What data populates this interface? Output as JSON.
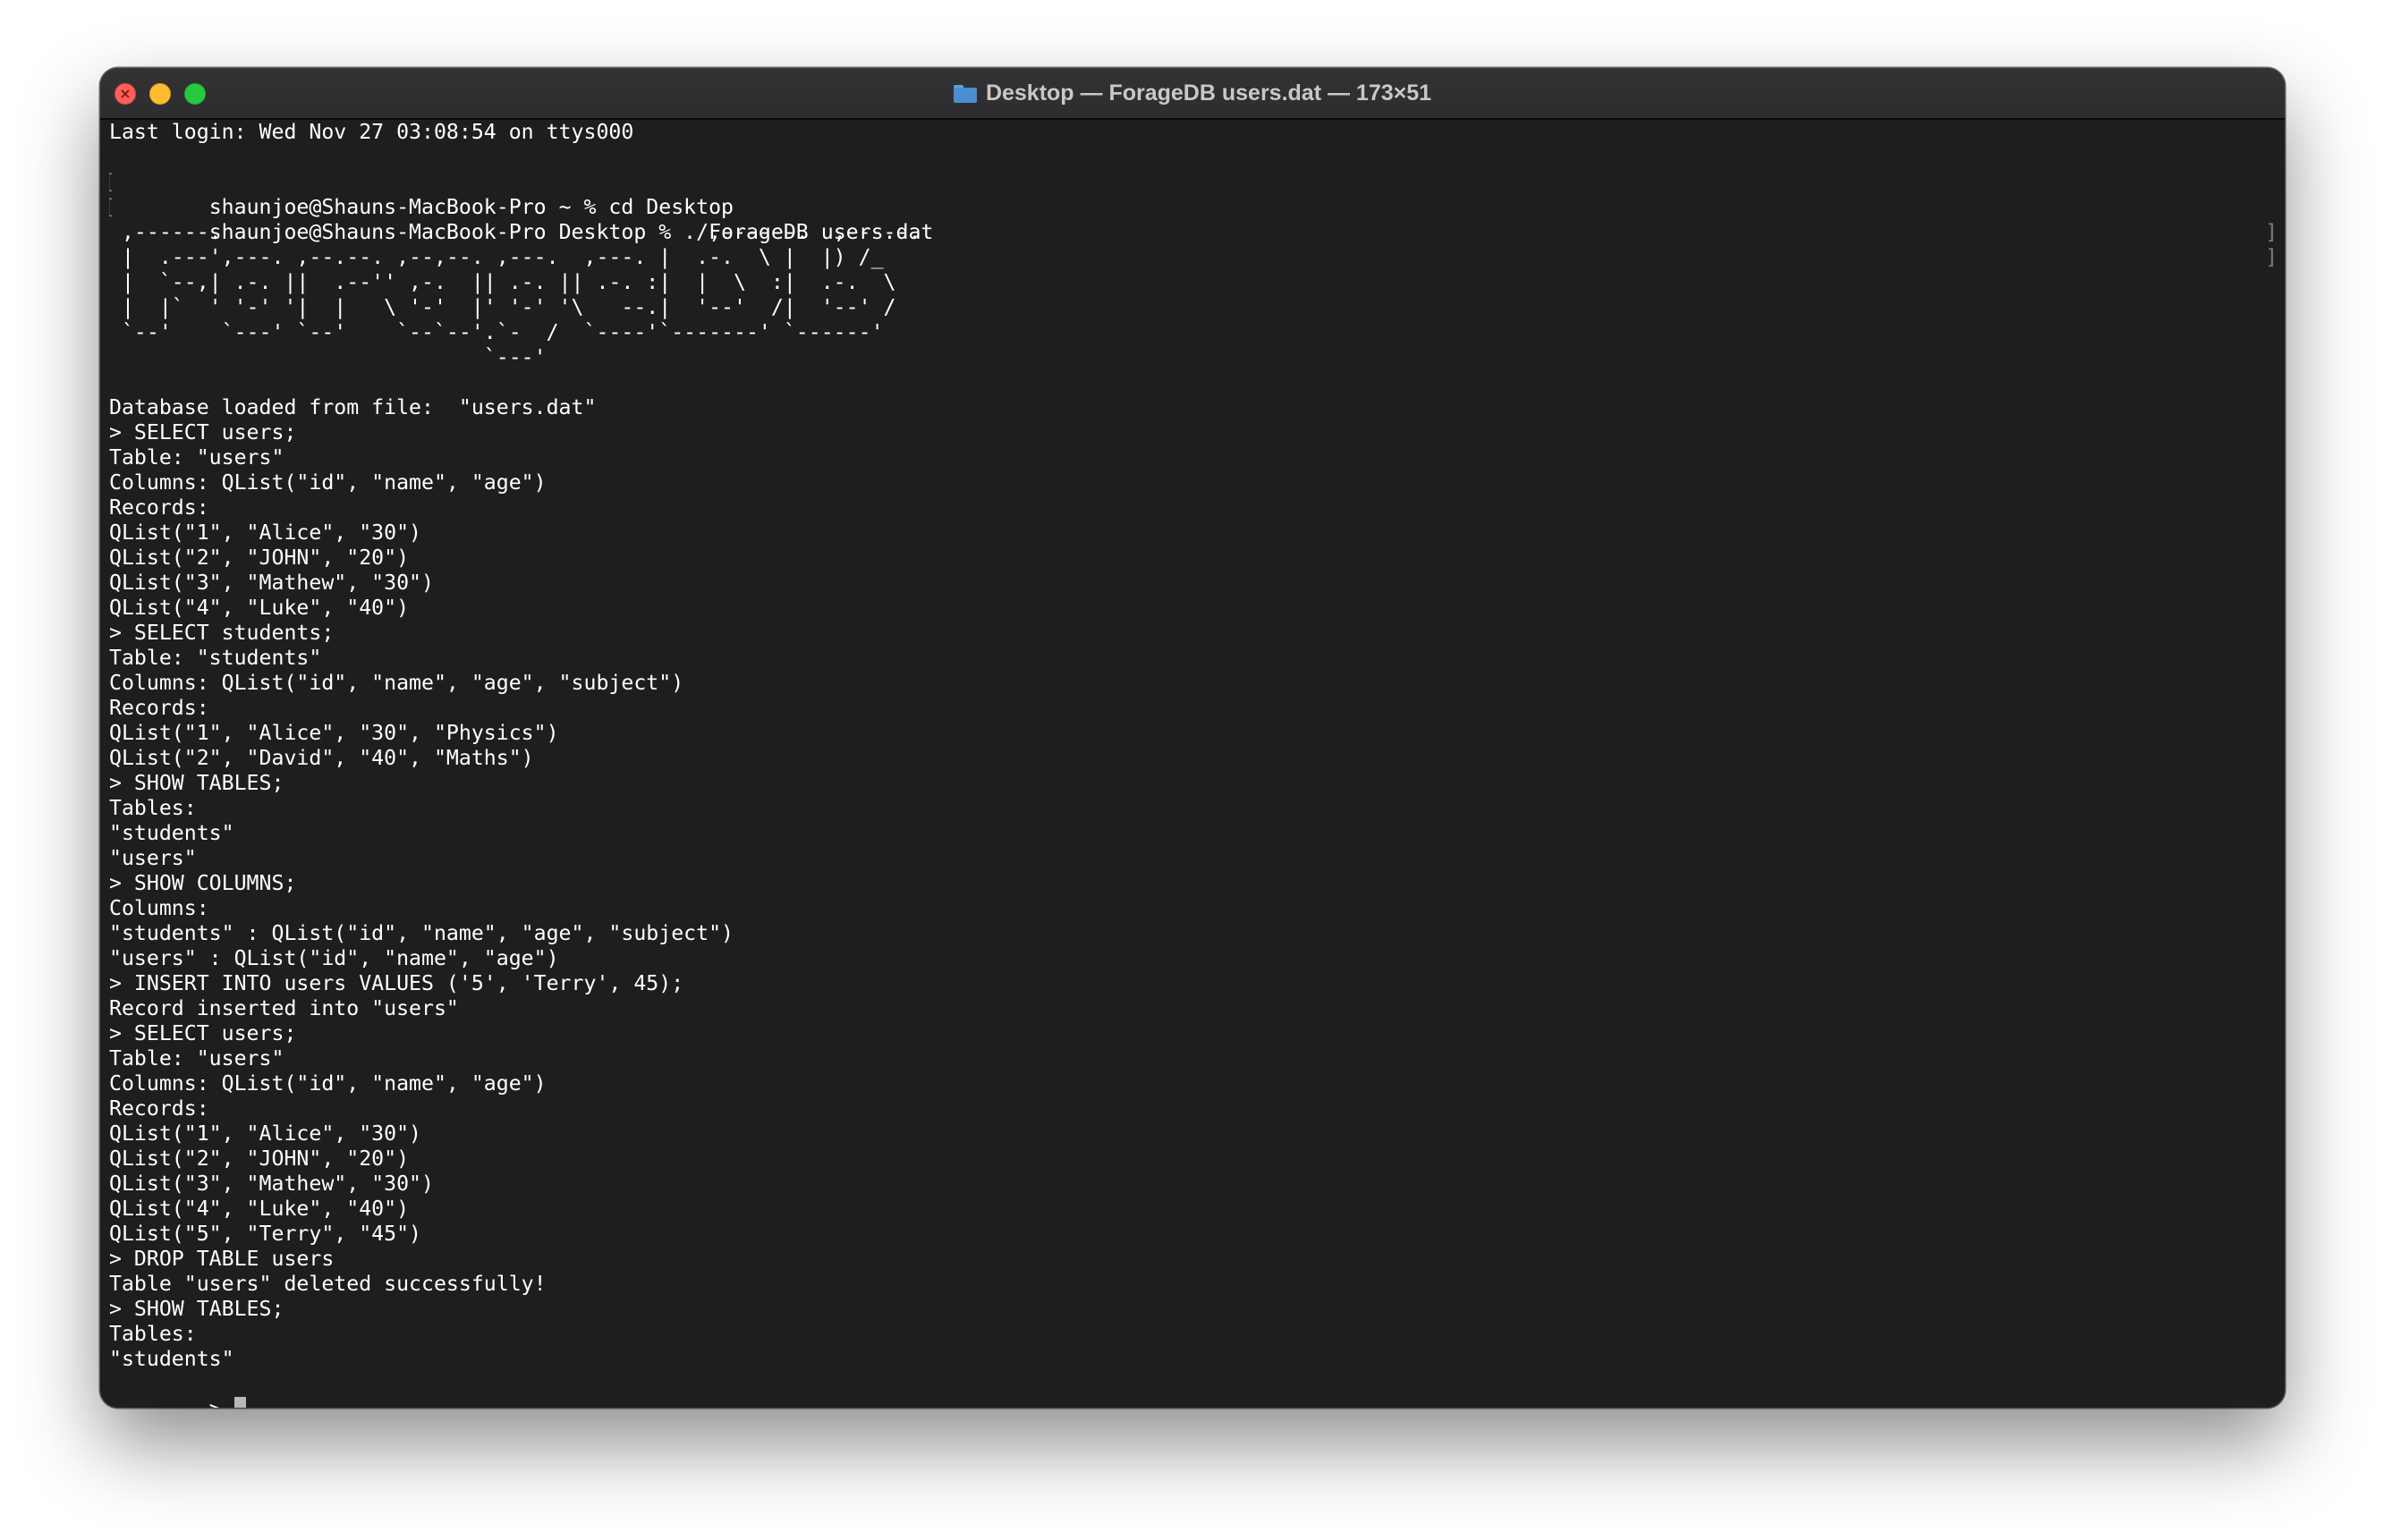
{
  "window": {
    "title": "Desktop — ForageDB users.dat — 173×51",
    "folder_icon": "folder-icon",
    "close_icon": "close-icon",
    "minimize_icon": "minimize-icon",
    "zoom_icon": "zoom-icon",
    "close_glyph": "×"
  },
  "session": {
    "last_login": "Last login: Wed Nov 27 03:08:54 on ttys000",
    "cmd_cd": "shaunjoe@Shauns-MacBook-Pro ~ % cd Desktop",
    "cmd_run": "shaunjoe@Shauns-MacBook-Pro Desktop % ./ForageDB users.dat",
    "bracket_open": "[",
    "bracket_close": "]"
  },
  "banner": " ,------.                                       ,------.  ,-----.\n |  .---',---. ,--.--. ,--,--. ,---.  ,---. |  .-.  \\ |  |) /_\n |  `--,| .-. ||  .--'' ,-.  || .-. || .-. :|  |  \\  :|  .-.  \\\n |  |`  ' '-' '|  |   \\ '-'  |' '-' '\\   --.|  '--'  /|  '--' /\n `--'    `---' `--'    `--`--'.`-  /  `----'`-------' `------'\n                              `---'",
  "output": [
    "",
    "Database loaded from file:  \"users.dat\"",
    "> SELECT users;",
    "Table: \"users\"",
    "Columns: QList(\"id\", \"name\", \"age\")",
    "Records:",
    "QList(\"1\", \"Alice\", \"30\")",
    "QList(\"2\", \"JOHN\", \"20\")",
    "QList(\"3\", \"Mathew\", \"30\")",
    "QList(\"4\", \"Luke\", \"40\")",
    "> SELECT students;",
    "Table: \"students\"",
    "Columns: QList(\"id\", \"name\", \"age\", \"subject\")",
    "Records:",
    "QList(\"1\", \"Alice\", \"30\", \"Physics\")",
    "QList(\"2\", \"David\", \"40\", \"Maths\")",
    "> SHOW TABLES;",
    "Tables:",
    "\"students\"",
    "\"users\"",
    "> SHOW COLUMNS;",
    "Columns:",
    "\"students\" : QList(\"id\", \"name\", \"age\", \"subject\")",
    "\"users\" : QList(\"id\", \"name\", \"age\")",
    "> INSERT INTO users VALUES ('5', 'Terry', 45);",
    "Record inserted into \"users\"",
    "> SELECT users;",
    "Table: \"users\"",
    "Columns: QList(\"id\", \"name\", \"age\")",
    "Records:",
    "QList(\"1\", \"Alice\", \"30\")",
    "QList(\"2\", \"JOHN\", \"20\")",
    "QList(\"3\", \"Mathew\", \"30\")",
    "QList(\"4\", \"Luke\", \"40\")",
    "QList(\"5\", \"Terry\", \"45\")",
    "> DROP TABLE users",
    "Table \"users\" deleted successfully!",
    "> SHOW TABLES;",
    "Tables:",
    "\"students\""
  ],
  "prompt": "> ",
  "colors": {
    "terminal_bg": "#1e1e1e",
    "text": "#ffffff",
    "titlebar": "#2d2d2f",
    "close": "#ff5f57",
    "minimize": "#febc2e",
    "zoom": "#28c840"
  }
}
